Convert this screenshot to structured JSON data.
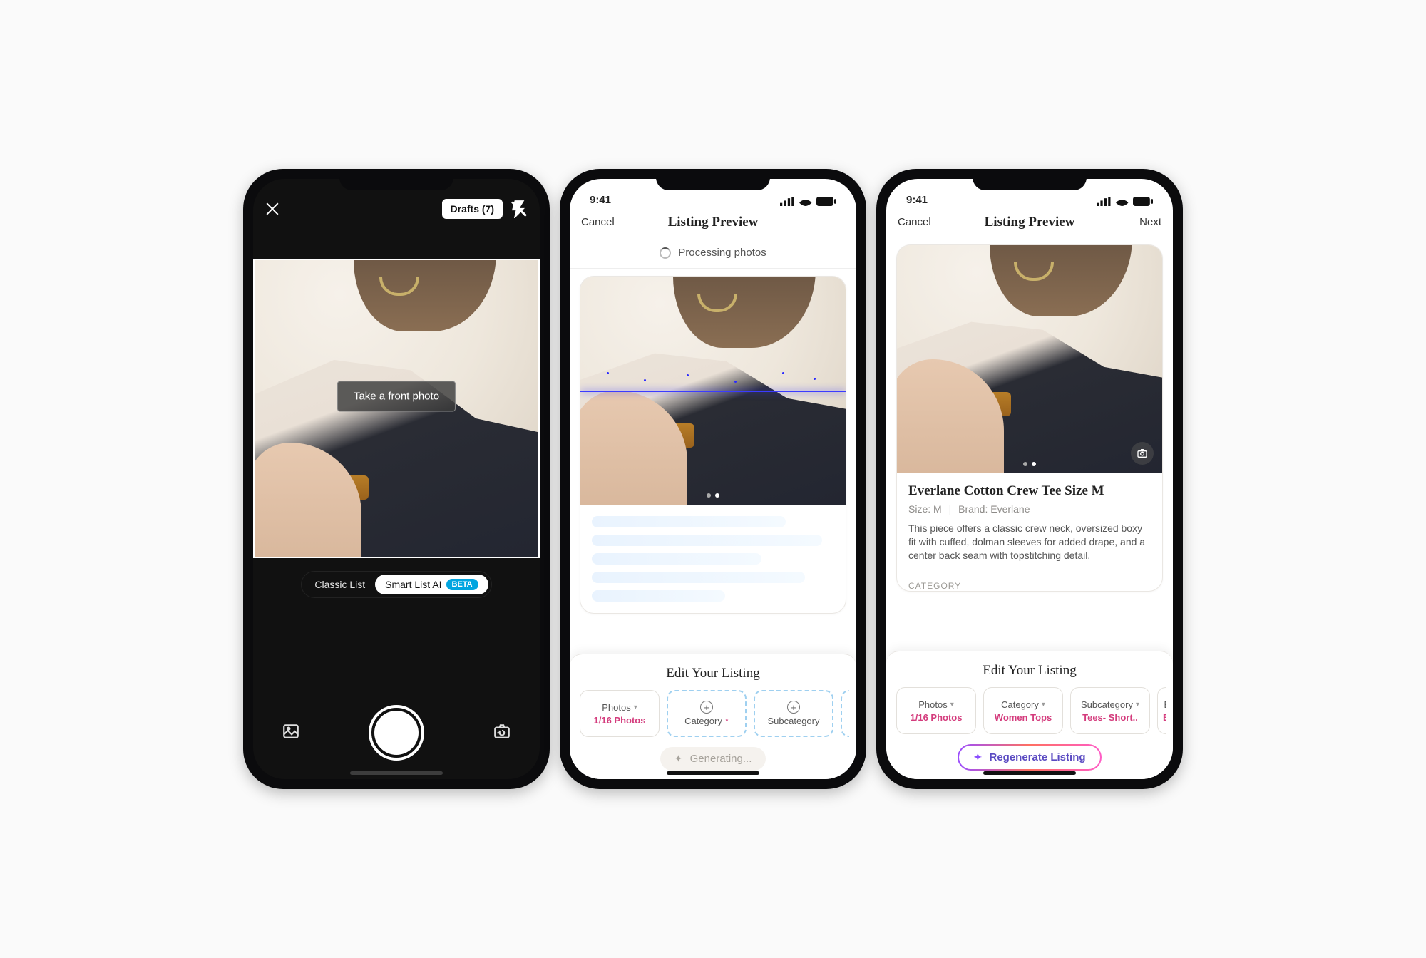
{
  "screen1": {
    "drafts_label": "Drafts (7)",
    "overlay_text": "Take a front photo",
    "mode_classic": "Classic List",
    "mode_smart": "Smart List AI",
    "beta_tag": "BETA"
  },
  "status": {
    "time": "9:41"
  },
  "nav": {
    "cancel": "Cancel",
    "next": "Next",
    "title": "Listing Preview"
  },
  "processing_label": "Processing photos",
  "sheet": {
    "title": "Edit Your Listing",
    "photos_label": "Photos",
    "photos_count": "1/16 Photos",
    "category_label": "Category",
    "subcategory_label": "Subcategory",
    "category_value": "Women Tops",
    "subcategory_value": "Tees- Short..",
    "brand_partial_1": "B",
    "brand_partial_3_label": "Br",
    "brand_partial_3_value": "Ev",
    "generating": "Generating...",
    "regenerate": "Regenerate Listing"
  },
  "listing": {
    "title": "Everlane Cotton Crew Tee Size M",
    "size_label": "Size:",
    "size_value": "M",
    "brand_label": "Brand:",
    "brand_value": "Everlane",
    "description": "This piece offers a classic crew neck, oversized boxy fit with cuffed, dolman sleeves for added drape, and a center back seam with topstitching detail.",
    "category_heading": "CATEGORY"
  }
}
